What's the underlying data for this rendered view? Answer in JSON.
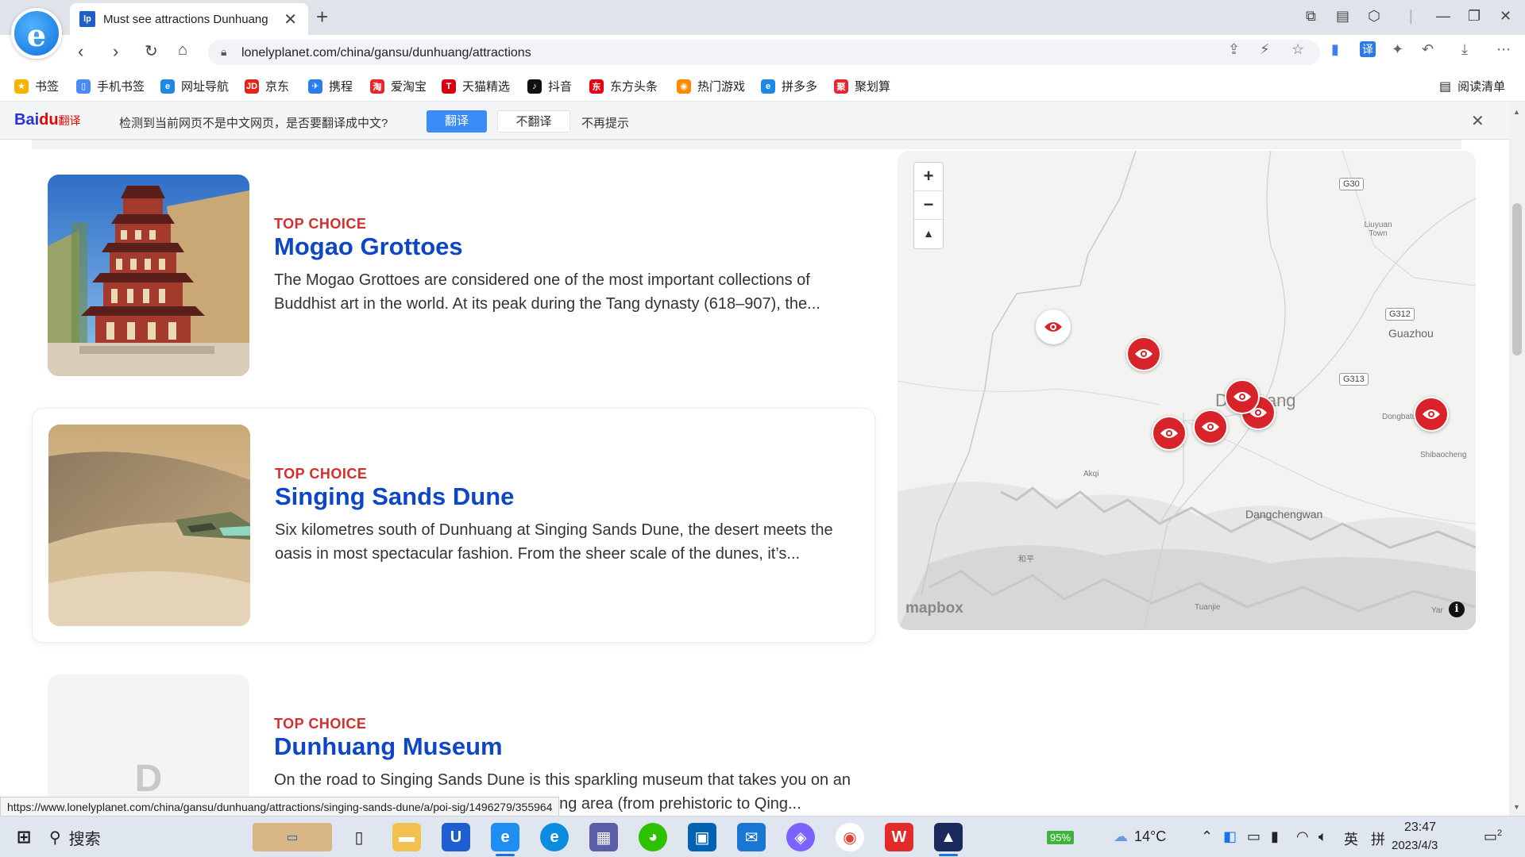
{
  "browser": {
    "tab_title": "Must see attractions Dunhuang",
    "tab_favicon": "lp",
    "new_tab_label": "+",
    "url": "lonelyplanet.com/china/gansu/dunhuang/attractions"
  },
  "bookmarks": [
    {
      "label": "书签",
      "icon": "star-icon",
      "color": "#f5b400",
      "glyph": "★"
    },
    {
      "label": "手机书签",
      "icon": "phone-icon",
      "color": "#4a8af4",
      "glyph": "▯"
    },
    {
      "label": "网址导航",
      "icon": "nav-icon",
      "color": "#1e88e5",
      "glyph": "e"
    },
    {
      "label": "京东",
      "icon": "jd-icon",
      "color": "#e1251b",
      "glyph": "JD"
    },
    {
      "label": "携程",
      "icon": "ctrip-icon",
      "color": "#2b7de9",
      "glyph": "✈"
    },
    {
      "label": "爱淘宝",
      "icon": "taobao-icon",
      "color": "#e8262f",
      "glyph": "淘"
    },
    {
      "label": "天猫精选",
      "icon": "tmall-icon",
      "color": "#d7000f",
      "glyph": "T"
    },
    {
      "label": "抖音",
      "icon": "douyin-icon",
      "color": "#111111",
      "glyph": "♪"
    },
    {
      "label": "东方头条",
      "icon": "dftt-icon",
      "color": "#e60012",
      "glyph": "东"
    },
    {
      "label": "热门游戏",
      "icon": "game-icon",
      "color": "#ff8a00",
      "glyph": "◉"
    },
    {
      "label": "拼多多",
      "icon": "pdd-icon",
      "color": "#1e88e5",
      "glyph": "e"
    },
    {
      "label": "聚划算",
      "icon": "jhs-icon",
      "color": "#e8262f",
      "glyph": "聚"
    }
  ],
  "reading_list": "阅读清单",
  "translate_bar": {
    "brand": "Bai",
    "brand_du": "du",
    "brand_sub": "翻译",
    "message": "检测到当前网页不是中文网页，是否要翻译成中文?",
    "translate": "翻译",
    "dont_translate": "不翻译",
    "never": "不再提示"
  },
  "attractions": [
    {
      "kicker": "TOP CHOICE",
      "name": "Mogao Grottoes",
      "description": "The Mogao Grottoes are considered one of the most important collections of Buddhist art in the world. At its peak during the Tang dynasty (618–907), the..."
    },
    {
      "kicker": "TOP CHOICE",
      "name": "Singing Sands Dune",
      "description": "Six kilometres south of Dunhuang at Singing Sands Dune, the desert meets the oasis in most spectacular fashion. From the sheer scale of the dunes, it’s..."
    },
    {
      "kicker": "TOP CHOICE",
      "name": "Dunhuang Museum",
      "description": "On the road to Singing Sands Dune is this sparkling museum that takes you on an artefact-rich journey through the Dunhuang area (from prehistoric to Qing...",
      "placeholder_letter": "D"
    }
  ],
  "map": {
    "zoom_in": "+",
    "zoom_out": "−",
    "compass": "▲",
    "labels": {
      "liuyuan": "Liuyuan Town",
      "guazhou": "Guazhou",
      "dunhuang": "Dunhuang",
      "dongbatu": "Dongbatu",
      "shibaocheng": "Shibaocheng",
      "akqi": "Akqi",
      "dangchengwan": "Dangchengwan",
      "heping": "和平",
      "tuanjie": "Tuanjie",
      "yar": "Yar"
    },
    "roads": {
      "g30": "G30",
      "g312": "G312",
      "g313": "G313"
    },
    "attribution": "mapbox",
    "info": "i"
  },
  "status_url": "https://www.lonelyplanet.com/china/gansu/dunhuang/attractions/singing-sands-dune/a/poi-sig/1496279/355964",
  "taskbar": {
    "search": "搜索",
    "battery": "95%",
    "weather": "14°C",
    "ime": "英",
    "ime2": "拼",
    "time": "23:47",
    "date": "2023/4/3",
    "notifications": "2"
  }
}
